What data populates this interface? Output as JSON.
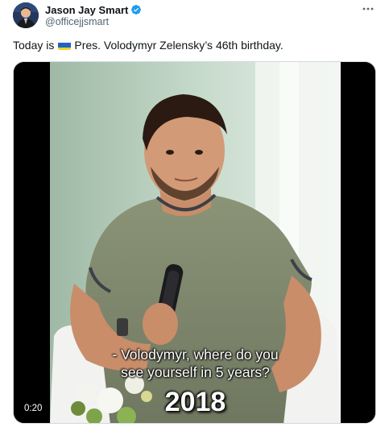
{
  "author": {
    "display_name": "Jason Jay Smart",
    "handle": "@officejjsmart",
    "verified_icon": "verified-badge-icon",
    "verified_color": "#1d9bf0"
  },
  "tweet": {
    "text_before_flag": "Today is",
    "flag_icon": "ukraine-flag-icon",
    "text_after_flag": "Pres. Volodymyr Zelensky’s 46th birthday."
  },
  "menu": {
    "icon": "more-options-icon"
  },
  "media": {
    "subtitle_line1": "- Volodymyr, where do you",
    "subtitle_line2": "see yourself in 5 years?",
    "year_caption": "2018",
    "duration": "0:20"
  }
}
